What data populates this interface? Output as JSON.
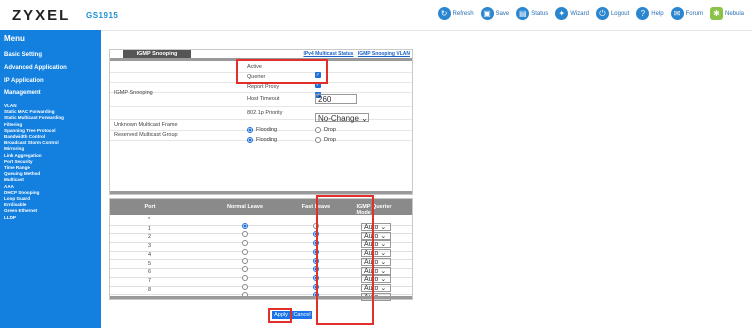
{
  "header": {
    "brand": "ZYXEL",
    "model": "GS1915",
    "nav": [
      {
        "label": "Refresh",
        "icon": "refresh-icon"
      },
      {
        "label": "Save",
        "icon": "save-icon"
      },
      {
        "label": "Status",
        "icon": "status-icon"
      },
      {
        "label": "Wizard",
        "icon": "wizard-icon"
      },
      {
        "label": "Logout",
        "icon": "logout-icon"
      },
      {
        "label": "Help",
        "icon": "help-icon"
      },
      {
        "label": "Forum",
        "icon": "forum-icon"
      },
      {
        "label": "Nebula",
        "icon": "nebula-icon"
      }
    ]
  },
  "sidebar": {
    "title": "Menu",
    "sections": [
      "Basic Setting",
      "Advanced Application",
      "IP Application",
      "Management"
    ],
    "items": [
      "VLAN",
      "Static MAC Forwarding",
      "Static Multicast Forwarding",
      "Filtering",
      "Spanning Tree Protocol",
      "Bandwidth Control",
      "Broadcast Storm Control",
      "Mirroring",
      "Link Aggregation",
      "Port Security",
      "Time Range",
      "Queuing Method",
      "Multicast",
      "AAA",
      "DHCP Snooping",
      "Loop Guard",
      "Errdisable",
      "Green Ethernet",
      "LLDP"
    ]
  },
  "panel": {
    "tab": "IGMP Snooping",
    "links": [
      "IPv4 Multicast Status",
      "IGMP Snooping VLAN"
    ],
    "group_label": "IGMP Snooping",
    "active_label": "Active",
    "querier_label": "Querier",
    "report_proxy_label": "Report Proxy",
    "host_timeout_label": "Host Timeout",
    "host_timeout_value": "260",
    "priority_label": "802.1p Priority",
    "priority_value": "No-Change",
    "unknown_label": "Unknown Multicast Frame",
    "reserved_label": "Reserved Multicast Group",
    "flooding": "Flooding",
    "drop": "Drop"
  },
  "table": {
    "headers": [
      "Port",
      "Normal Leave",
      "Fast Leave",
      "IGMP Querier Mode"
    ],
    "rows": [
      {
        "port": "*",
        "normal": true,
        "fast": false,
        "mode": "Auto"
      },
      {
        "port": "1",
        "normal": false,
        "fast": true,
        "mode": "Auto"
      },
      {
        "port": "2",
        "normal": false,
        "fast": true,
        "mode": "Auto"
      },
      {
        "port": "3",
        "normal": false,
        "fast": true,
        "mode": "Auto"
      },
      {
        "port": "4",
        "normal": false,
        "fast": true,
        "mode": "Auto"
      },
      {
        "port": "5",
        "normal": false,
        "fast": true,
        "mode": "Auto"
      },
      {
        "port": "6",
        "normal": false,
        "fast": true,
        "mode": "Auto"
      },
      {
        "port": "7",
        "normal": false,
        "fast": true,
        "mode": "Auto"
      },
      {
        "port": "8",
        "normal": false,
        "fast": true,
        "mode": "Auto"
      }
    ]
  },
  "buttons": {
    "apply": "Apply",
    "cancel": "Cancel"
  }
}
